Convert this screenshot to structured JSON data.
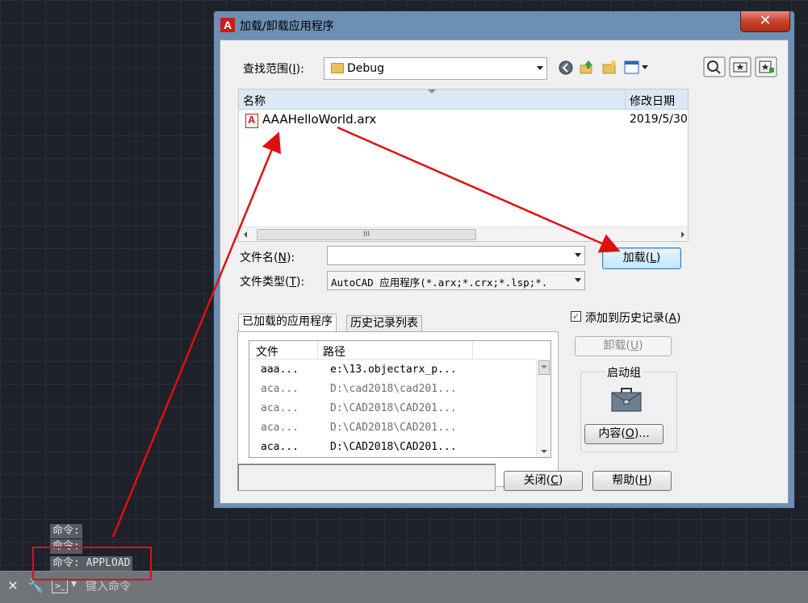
{
  "command_history": [
    "命令:",
    "命令:",
    "命令: APPLOAD"
  ],
  "command_bar": {
    "input_placeholder": "键入命令"
  },
  "dialog": {
    "title": "加载/卸载应用程序",
    "title_icon": "A",
    "close_glyph": "✕",
    "lookin_label": "查找范围",
    "lookin_hotkey": "I",
    "lookin_value": "Debug",
    "file_list": {
      "columns": [
        "名称",
        "修改日期"
      ],
      "rows": [
        {
          "name": "AAAHelloWorld.arx",
          "date": "2019/5/30"
        }
      ]
    },
    "filename_label": "文件名",
    "filename_hotkey": "N",
    "filename_value": "",
    "filetype_label": "文件类型",
    "filetype_hotkey": "T",
    "filetype_value": "AutoCAD 应用程序(*.arx;*.crx;*.lsp;*.",
    "load_button": {
      "label": "加载",
      "hotkey": "L"
    },
    "tabs": [
      "已加载的应用程序",
      "历史记录列表"
    ],
    "loaded_list": {
      "columns": [
        "文件",
        "路径"
      ],
      "rows": [
        {
          "file": "aaa...",
          "path": "e:\\13.objectarx_p..."
        },
        {
          "file": "aca...",
          "path": "D:\\cad2018\\cad201..."
        },
        {
          "file": "aca...",
          "path": "D:\\CAD2018\\CAD201..."
        },
        {
          "file": "aca...",
          "path": "D:\\CAD2018\\CAD201..."
        },
        {
          "file": "aca...",
          "path": "D:\\CAD2018\\CAD201..."
        }
      ]
    },
    "add_history": {
      "label": "添加到历史记录",
      "hotkey": "A",
      "checked": true
    },
    "unload_button": {
      "label": "卸载",
      "hotkey": "U"
    },
    "startup_group": {
      "title": "启动组"
    },
    "contents_button": {
      "label": "内容",
      "hotkey": "O",
      "suffix": "..."
    },
    "close_button": {
      "label": "关闭",
      "hotkey": "C"
    },
    "help_button": {
      "label": "帮助",
      "hotkey": "H"
    }
  },
  "colors": {
    "annotation_red": "#e01010",
    "title_bar": "#6d8fb3",
    "close_red": "#c8432e"
  }
}
